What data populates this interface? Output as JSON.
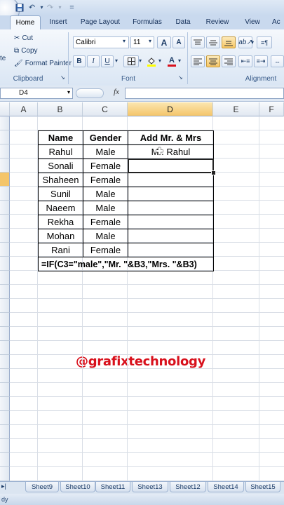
{
  "quick_access": {
    "customize": "="
  },
  "tabs": [
    "Home",
    "Insert",
    "Page Layout",
    "Formulas",
    "Data",
    "Review",
    "View"
  ],
  "tab_view_partial": "Ac",
  "clipboard": {
    "paste": "te",
    "cut": "Cut",
    "copy": "Copy",
    "format_painter": "Format Painter",
    "label": "Clipboard"
  },
  "font": {
    "name": "Calibri",
    "size": "11",
    "grow": "A",
    "shrink": "A",
    "bold": "B",
    "italic": "I",
    "underline": "U",
    "label": "Font",
    "font_color": "A"
  },
  "alignment": {
    "label": "Alignment"
  },
  "formula_bar": {
    "name_box": "D4",
    "fx": "fx",
    "content": ""
  },
  "columns": [
    "A",
    "B",
    "C",
    "D",
    "E",
    "F"
  ],
  "table": {
    "headers": [
      "Name",
      "Gender",
      "Add Mr. & Mrs"
    ],
    "rows": [
      [
        "Rahul",
        "Male",
        "Mr. Rahul"
      ],
      [
        "Sonali",
        "Female",
        ""
      ],
      [
        "Shaheen",
        "Female",
        ""
      ],
      [
        "Sunil",
        "Male",
        ""
      ],
      [
        "Naeem",
        "Male",
        ""
      ],
      [
        "Rekha",
        "Female",
        ""
      ],
      [
        "Mohan",
        "Male",
        ""
      ],
      [
        "Rani",
        "Female",
        ""
      ]
    ],
    "formula_note": "=IF(C3=\"male\",\"Mr. \"&B3,\"Mrs. \"&B3)"
  },
  "watermark": "@grafixtechnology",
  "sheet_tabs": [
    "Sheet9",
    "Sheet10",
    "Sheet11",
    "Sheet13",
    "Sheet12",
    "Sheet14",
    "Sheet15"
  ],
  "status": "dy",
  "colors": {
    "accent": "#f4c56a",
    "watermark": "#d8101c",
    "ribbon": "#dae6f4"
  }
}
